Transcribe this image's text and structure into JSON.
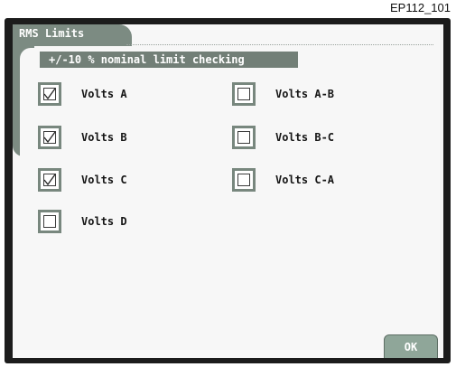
{
  "figure_id": "EP112_101",
  "panel": {
    "title": "RMS Limits"
  },
  "banner": "+/-10 % nominal limit checking",
  "checkboxes": [
    {
      "label": "Volts A",
      "checked": true
    },
    {
      "label": "Volts B",
      "checked": true
    },
    {
      "label": "Volts C",
      "checked": true
    },
    {
      "label": "Volts D",
      "checked": false
    },
    {
      "label": "Volts A-B",
      "checked": false
    },
    {
      "label": "Volts B-C",
      "checked": false
    },
    {
      "label": "Volts C-A",
      "checked": false
    }
  ],
  "buttons": {
    "ok": "OK"
  },
  "colors": {
    "panel": "#7c8b82",
    "banner": "#727f77",
    "checkbox_border": "#78877e",
    "ok_button": "#8fa699",
    "bezel": "#1c1c1c"
  }
}
